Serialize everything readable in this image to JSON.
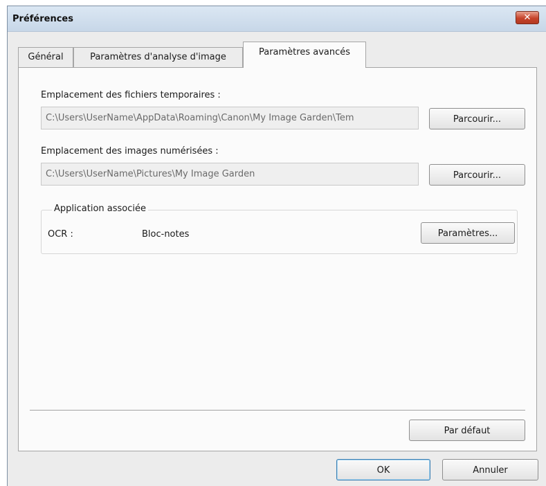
{
  "window": {
    "title": "Préférences",
    "close_glyph": "✕"
  },
  "tabs": [
    {
      "label": "Général",
      "active": false
    },
    {
      "label": "Paramètres d'analyse d'image",
      "active": false
    },
    {
      "label": "Paramètres avancés",
      "active": true
    }
  ],
  "temp_files": {
    "label": "Emplacement des fichiers temporaires :",
    "path": "C:\\Users\\UserName\\AppData\\Roaming\\Canon\\My Image Garden\\Tem",
    "browse_label": "Parcourir..."
  },
  "scanned_images": {
    "label": "Emplacement des images numérisées :",
    "path": "C:\\Users\\UserName\\Pictures\\My Image Garden",
    "browse_label": "Parcourir..."
  },
  "associated_app": {
    "group_label": "Application associée",
    "ocr_label": "OCR :",
    "ocr_value": "Bloc-notes",
    "settings_label": "Paramètres..."
  },
  "defaults_label": "Par défaut",
  "footer": {
    "ok_label": "OK",
    "cancel_label": "Annuler"
  },
  "colors": {
    "title_bar": "#c7d7e8",
    "close_button": "#c6432b",
    "dialog_bg": "#ececec",
    "panel_bg": "#fbfbfb",
    "default_button_border": "#3c7fb1"
  }
}
